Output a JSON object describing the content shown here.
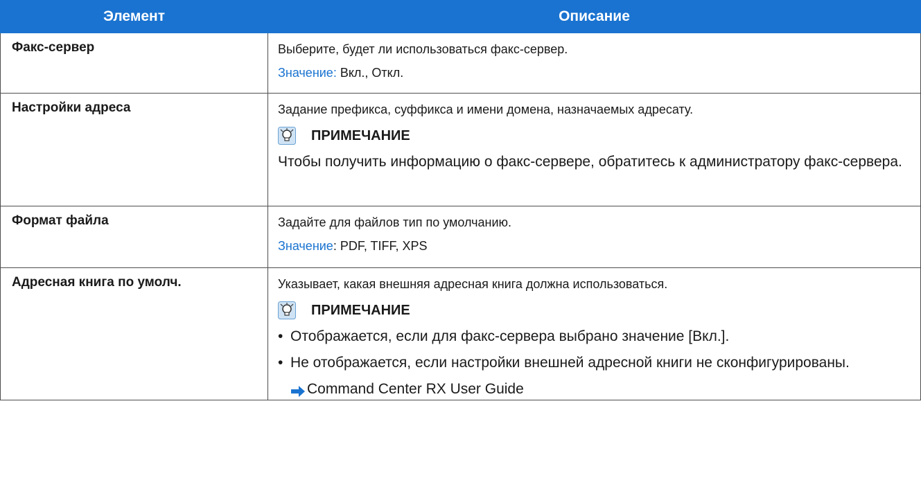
{
  "header": {
    "col_item": "Элемент",
    "col_desc": "Описание"
  },
  "rows": [
    {
      "item": "Факс-сервер",
      "desc": "Выберите, будет ли использоваться факс-сервер.",
      "value_label": "Значение:",
      "value": "Вкл., Откл."
    },
    {
      "item": "Настройки адреса",
      "desc": "Задание префикса, суффикса и имени домена, назначаемых адресату.",
      "note_title": "ПРИМЕЧАНИЕ",
      "note_text": "Чтобы получить информацию о факс-сервере, обратитесь к администратору факс-сервера."
    },
    {
      "item": "Формат файла",
      "desc": "Задайте для файлов тип по умолчанию.",
      "value_label": "Значение",
      "value": ": PDF, TIFF, XPS"
    },
    {
      "item": "Адресная книга по умолч.",
      "desc": "Указывает, какая внешняя адресная книга должна использоваться.",
      "note_title": "ПРИМЕЧАНИЕ",
      "bullets": [
        "Отображается, если для факс-сервера выбрано значение [Вкл.].",
        "Не отображается, если настройки внешней адресной книги не сконфигурированы."
      ],
      "bullet_mark": "•",
      "link": "Command Center RX User Guide"
    }
  ],
  "colors": {
    "header_bg": "#1a73d0",
    "value_label": "#1a73d0",
    "border": "#4d4d4d"
  },
  "icons": {
    "note": "lightbulb-note-icon",
    "link": "right-arrow-icon"
  }
}
